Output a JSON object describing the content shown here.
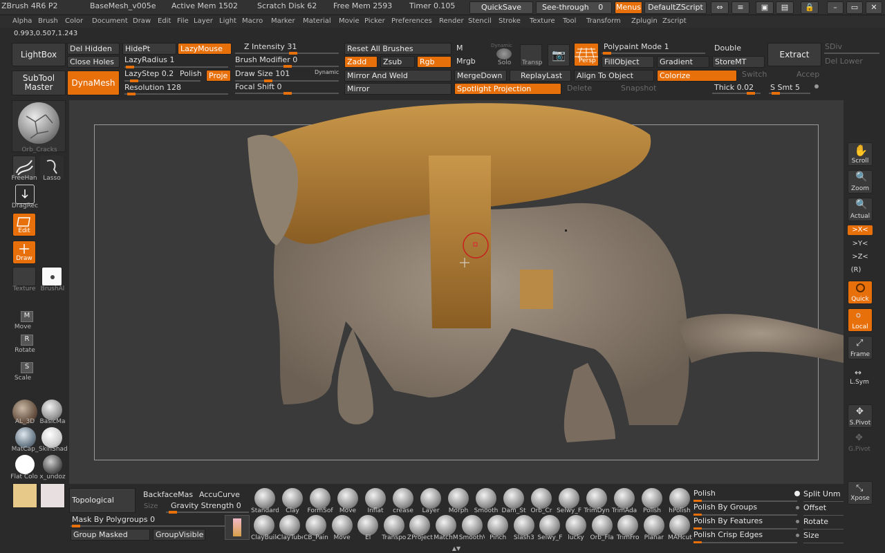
{
  "title": {
    "app": "ZBrush 4R6 P2",
    "doc": "BaseMesh_v005e",
    "active_mem": "Active Mem 1502",
    "scratch": "Scratch Disk 62",
    "free_mem": "Free Mem 2593",
    "timer": "Timer 0.105",
    "quicksave": "QuickSave",
    "seethrough": "See-through",
    "seethrough_val": "0",
    "menus": "Menus",
    "zscript": "DefaultZScript"
  },
  "menu": [
    "Alpha",
    "Brush",
    "Color",
    "Document",
    "Draw",
    "Edit",
    "File",
    "Layer",
    "Light",
    "Macro",
    "Marker",
    "Material",
    "Movie",
    "Picker",
    "Preferences",
    "Render",
    "Stencil",
    "Stroke",
    "Texture",
    "Tool",
    "Transform",
    "Zplugin",
    "Zscript"
  ],
  "coords": "0.993,0.507,1.243",
  "top": {
    "lightbox": "LightBox",
    "subtool": "SubTool",
    "master": "Master",
    "dynamesh": "DynaMesh",
    "del_hidden": "Del Hidden",
    "close_holes": "Close Holes",
    "hidept": "HidePt",
    "lazymouse": "LazyMouse",
    "lazyradius": "LazyRadius 1",
    "lazystep": "LazyStep 0.2",
    "polish": "Polish",
    "proje": "Proje",
    "resolution": "Resolution 128",
    "z_intensity": "Z Intensity 31",
    "brush_modifier": "Brush Modifier 0",
    "draw_size": "Draw Size 101",
    "dynamic": "Dynamic",
    "focal_shift": "Focal Shift 0",
    "reset_brushes": "Reset All Brushes",
    "zadd": "Zadd",
    "zsub": "Zsub",
    "rgb": "Rgb",
    "mirror_weld": "Mirror And Weld",
    "mirror": "Mirror",
    "m": "M",
    "mrgb": "Mrgb",
    "solo": "Solo",
    "solo_top": "Dynamic",
    "transp": "Transp",
    "mergedown": "MergeDown",
    "replaylast": "ReplayLast",
    "spotlight": "Spotlight Projection",
    "delete": "Delete",
    "snapshot": "Snapshot",
    "persp": "Persp",
    "polypaint_mode": "Polypaint Mode 1",
    "fillobject": "FillObject",
    "gradient": "Gradient",
    "align": "Align To Object",
    "colorize": "Colorize",
    "switch": "Switch",
    "double": "Double",
    "storemt": "StoreMT",
    "extract": "Extract",
    "thick": "Thick 0.02",
    "s_smt": "S Smt 5",
    "sdiv": "SDiv",
    "del_lower": "Del Lower",
    "accep": "Accep"
  },
  "left": {
    "material_name": "Orb_Cracks",
    "freehand": "FreeHan",
    "lasso": "Lasso",
    "dragrect": "DragRec",
    "edit": "Edit",
    "draw": "Draw",
    "texture": "Texture",
    "brushalpha": "BrushAl",
    "move": "Move",
    "rotate": "Rotate",
    "scale": "Scale",
    "mats": [
      "AL_3D",
      "BasicMa",
      "MatCap_",
      "SkinShad",
      "Flat Colo",
      "x_undoz"
    ]
  },
  "right": {
    "scroll": "Scroll",
    "zoom": "Zoom",
    "actual": "Actual",
    "x": ">X<",
    "y": ">Y<",
    "z": ">Z<",
    "r": "(R)",
    "quick": "Quick",
    "local": "Local",
    "frame": "Frame",
    "lsym": "L.Sym",
    "spivot": "S.Pivot",
    "gpivot": "G.Pivot",
    "xpose": "Xpose"
  },
  "bottom": {
    "topological": "Topological",
    "backface": "BackfaceMas",
    "accucurve": "AccuCurve",
    "size": "Size",
    "gravity": "Gravity Strength 0",
    "mask_poly": "Mask By Polygroups 0",
    "group_masked": "Group Masked",
    "group_visible": "GroupVisible",
    "brushes_row1": [
      "Standard",
      "Clay",
      "FormSof",
      "Move",
      "Inflat",
      "crease",
      "Layer",
      "Morph",
      "Smooth",
      "Dam_St",
      "Orb_Cr",
      "Selwy_F",
      "TrimDyn",
      "TrimAda",
      "Polish",
      "hPolish"
    ],
    "brushes_row2": [
      "ClayBuild",
      "ClayTube",
      "CB_Pain",
      "Move",
      "El",
      "Transpo",
      "ZProject",
      "MatchM",
      "SmoothV",
      "Pinch",
      "Slash3",
      "Selwy_F",
      "lucky",
      "Orb_Fla",
      "TrimFro",
      "Planar",
      "MAHcut"
    ],
    "right_list": [
      "Polish",
      "Polish By Groups",
      "Polish By Features",
      "Polish Crisp Edges"
    ],
    "right_col": [
      "Split Unm",
      "Offset",
      "Rotate",
      "Size"
    ]
  }
}
